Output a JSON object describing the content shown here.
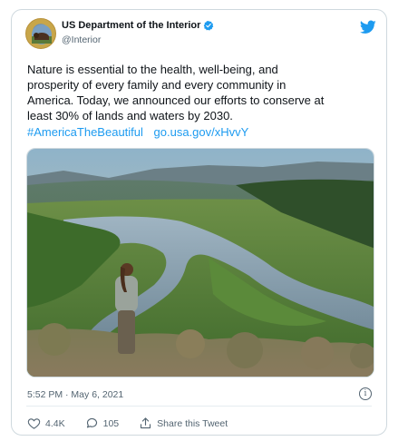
{
  "account": {
    "name": "US Department of the Interior",
    "handle": "@Interior",
    "verified_icon": "verified-badge-icon",
    "logo_icon": "bison-seal-icon"
  },
  "platform_icon": "twitter-bird-icon",
  "tweet": {
    "text": "Nature is essential to the health, well-being, and\nprosperity of every family and every community in\nAmerica. Today, we announced our efforts to conserve at\nleast 30% of lands and waters by 2030.",
    "hashtag": "#AmericaTheBeautiful",
    "link": "go.usa.gov/xHvvY",
    "timestamp": "5:52 PM · May 6, 2021"
  },
  "actions": {
    "likes": "4.4K",
    "replies": "105",
    "share_label": "Share this Tweet"
  },
  "colors": {
    "accent": "#1d9bf0",
    "muted": "#536471",
    "text": "#0f1419"
  }
}
